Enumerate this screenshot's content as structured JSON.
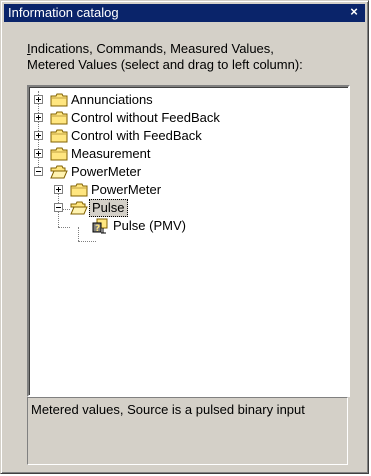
{
  "window": {
    "title": "Information catalog",
    "close_glyph": "×"
  },
  "instructions": {
    "line1_mnemonic": "I",
    "line1_rest": "ndications, Commands, Measured Values,",
    "line2": "Metered Values (select and drag to left column):"
  },
  "tree": {
    "nodes": [
      {
        "label": "Annunciations",
        "icon": "folder-closed-icon",
        "expander": "plus",
        "level": 0
      },
      {
        "label": "Control without FeedBack",
        "icon": "folder-closed-icon",
        "expander": "plus",
        "level": 0
      },
      {
        "label": "Control with FeedBack",
        "icon": "folder-closed-icon",
        "expander": "plus",
        "level": 0
      },
      {
        "label": "Measurement",
        "icon": "folder-closed-icon",
        "expander": "plus",
        "level": 0
      },
      {
        "label": "PowerMeter",
        "icon": "folder-open-icon",
        "expander": "minus",
        "level": 0
      },
      {
        "label": "PowerMeter",
        "icon": "folder-closed-icon",
        "expander": "plus",
        "level": 1
      },
      {
        "label": "Pulse",
        "icon": "folder-open-icon",
        "expander": "minus",
        "level": 1,
        "selected": true
      },
      {
        "label": "Pulse (PMV)",
        "icon": "pulse-item-icon",
        "expander": "none",
        "level": 2
      }
    ]
  },
  "description": {
    "text": "Metered values, Source is a pulsed binary input"
  },
  "colors": {
    "titlebar": "#0a246a",
    "dialog_face": "#d4d0c8",
    "folder_yellow": "#ffe680"
  }
}
